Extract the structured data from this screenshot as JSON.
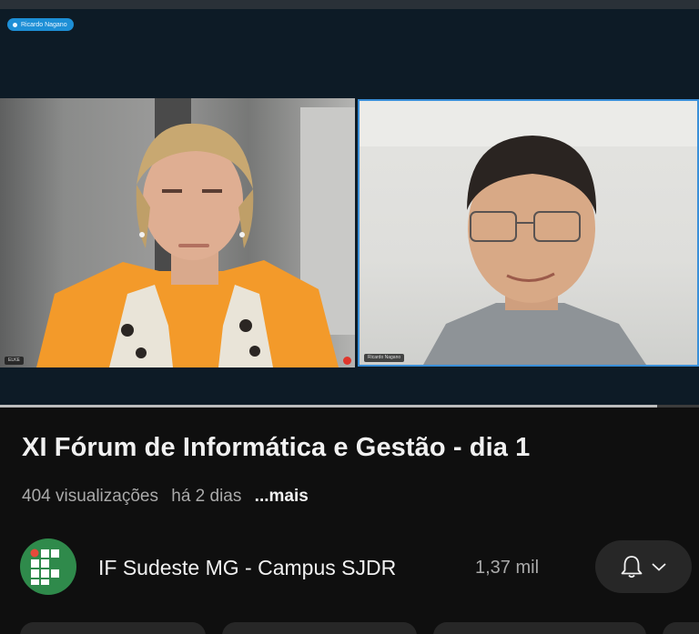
{
  "video": {
    "active_speaker": "Ricardo Nagano",
    "participants": [
      {
        "name": "ELKE",
        "muted": true
      },
      {
        "name": "Ricardo Nagano",
        "muted": false
      }
    ],
    "progress_fraction": 0.94
  },
  "title": "XI Fórum de Informática e Gestão - dia 1",
  "meta": {
    "views": "404 visualizações",
    "age": "há 2 dias",
    "more": "...mais"
  },
  "channel": {
    "name": "IF Sudeste MG - Campus SJDR",
    "subscribers": "1,37 mil",
    "avatar_icon": "if-logo-icon",
    "brand_color": "#2f8a4b"
  },
  "bell_icon": "bell-icon",
  "chevron_icon": "chevron-down-icon",
  "colors": {
    "background": "#0f0f0f",
    "active_tile_border": "#3a8fd8",
    "speaker_pill": "#1d8fd6",
    "muted_indicator": "#e0362c"
  }
}
